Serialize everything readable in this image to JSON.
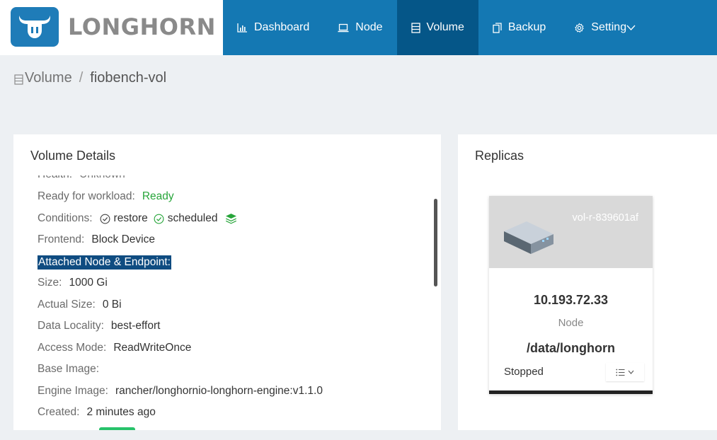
{
  "brand": {
    "name": "LONGHORN"
  },
  "nav": [
    {
      "label": "Dashboard",
      "icon": "bar-chart-icon"
    },
    {
      "label": "Node",
      "icon": "laptop-icon"
    },
    {
      "label": "Volume",
      "icon": "database-icon",
      "active": true
    },
    {
      "label": "Backup",
      "icon": "copy-icon"
    },
    {
      "label": "Setting",
      "icon": "gear-icon"
    }
  ],
  "breadcrumb": {
    "parent": "Volume",
    "separator": "/",
    "current": "fiobench-vol"
  },
  "details": {
    "title": "Volume Details",
    "health_label": "Health:",
    "health_value": "Unknown",
    "ready_label": "Ready for workload:",
    "ready_value": "Ready",
    "conditions_label": "Conditions:",
    "cond_restore": "restore",
    "cond_scheduled": "scheduled",
    "frontend_label": "Frontend:",
    "frontend_value": "Block Device",
    "attached_label": "Attached Node & Endpoint:",
    "size_label": "Size:",
    "size_value": "1000 Gi",
    "actual_label": "Actual Size:",
    "actual_value": "0 Bi",
    "locality_label": "Data Locality:",
    "locality_value": "best-effort",
    "access_label": "Access Mode:",
    "access_value": "ReadWriteOnce",
    "base_label": "Base Image:",
    "engine_label": "Engine Image:",
    "engine_value": "rancher/longhornio-longhorn-engine:v1.1.0",
    "created_label": "Created:",
    "created_value": "2 minutes ago"
  },
  "replicas": {
    "title": "Replicas",
    "name": "vol-r-839601af",
    "ip": "10.193.72.33",
    "node_label": "Node",
    "path": "/data/longhorn",
    "status": "Stopped"
  },
  "colors": {
    "header": "#1478b3",
    "nav_active": "#055688",
    "ready": "#27a53a",
    "highlight": "#0f4c81"
  }
}
